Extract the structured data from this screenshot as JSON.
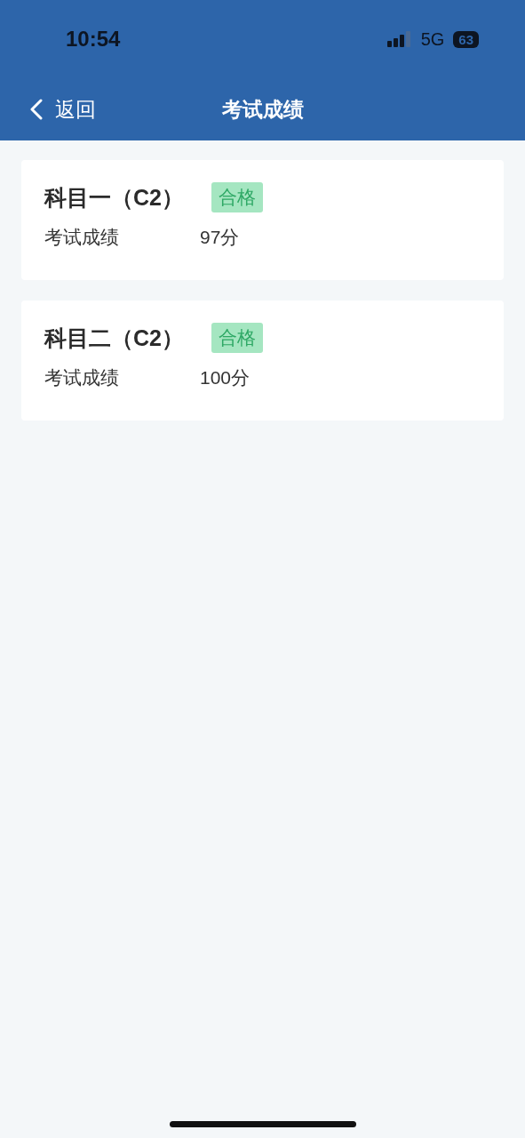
{
  "status_bar": {
    "time": "10:54",
    "network": "5G",
    "battery": "63"
  },
  "nav_bar": {
    "back": "返回",
    "title": "考试成绩"
  },
  "results": [
    {
      "subject": "科目一（C2）",
      "badge": "合格",
      "label": "考试成绩",
      "score": "97分"
    },
    {
      "subject": "科目二（C2）",
      "badge": "合格",
      "label": "考试成绩",
      "score": "100分"
    }
  ]
}
